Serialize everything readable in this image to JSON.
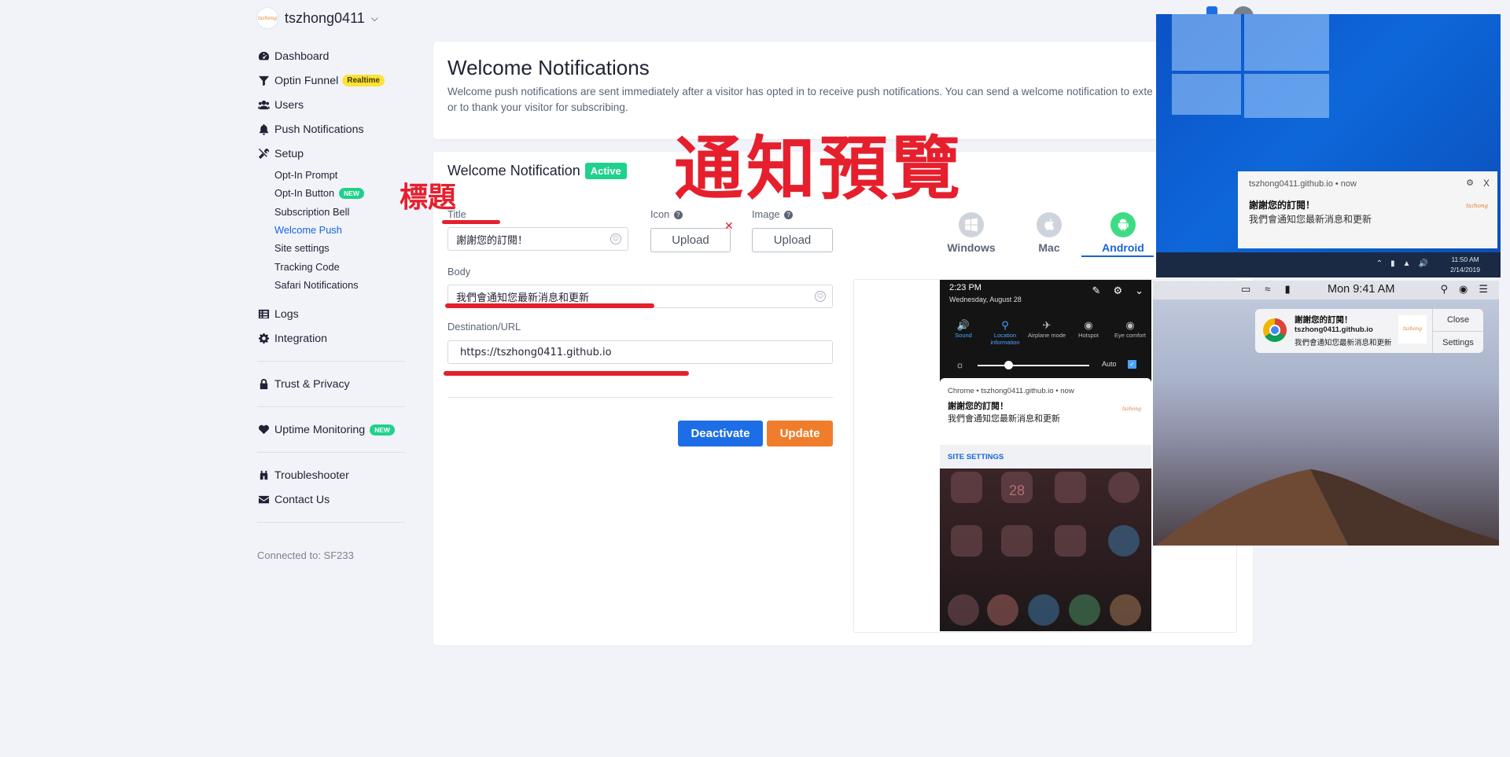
{
  "sidebar": {
    "account_name": "tszhong0411",
    "logo_text": "tszhong",
    "items": [
      {
        "label": "Dashboard",
        "icon": "dashboard-icon"
      },
      {
        "label": "Optin Funnel",
        "icon": "funnel-icon",
        "badge": "Realtime"
      },
      {
        "label": "Users",
        "icon": "users-icon"
      },
      {
        "label": "Push Notifications",
        "icon": "bell-icon"
      },
      {
        "label": "Setup",
        "icon": "tools-icon"
      }
    ],
    "setup_items": [
      "Opt-In Prompt",
      "Opt-In Button",
      "Subscription Bell",
      "Welcome Push",
      "Site settings",
      "Tracking Code",
      "Safari Notifications"
    ],
    "setup_new_badge": "NEW",
    "items2": [
      {
        "label": "Logs",
        "icon": "list-icon"
      },
      {
        "label": "Integration",
        "icon": "gear-icon"
      }
    ],
    "trust": "Trust & Privacy",
    "uptime": "Uptime Monitoring",
    "uptime_badge": "NEW",
    "troubleshooter": "Troubleshooter",
    "contact": "Contact Us",
    "connected": "Connected to: SF233"
  },
  "intro": {
    "title": "Welcome Notifications",
    "description": "Welcome push notifications are sent immediately after a visitor has opted in to receive push notifications. You can send a welcome notification to exte a warm welcome or to thank your visitor for subscribing."
  },
  "form": {
    "heading": "Welcome Notification",
    "status": "Active",
    "title_label": "Title",
    "title_value": "謝謝您的訂閱！",
    "icon_label": "Icon",
    "image_label": "Image",
    "upload": "Upload",
    "body_label": "Body",
    "body_value": "我們會通知您最新消息和更新",
    "url_label": "Destination/URL",
    "url_value": "https://tszhong0411.github.io",
    "deactivate": "Deactivate",
    "update": "Update"
  },
  "platforms": [
    {
      "label": "Windows",
      "icon": "windows-icon",
      "active": false
    },
    {
      "label": "Mac",
      "icon": "apple-icon",
      "active": false
    },
    {
      "label": "Android",
      "icon": "android-icon",
      "active": true
    }
  ],
  "android": {
    "time": "2:23 PM",
    "date": "Wednesday, August 28",
    "quick": [
      "Sound",
      "Location information",
      "Airplane mode",
      "Hotspot",
      "Eye comfort"
    ],
    "auto": "Auto",
    "app_line": "Chrome • tszhong0411.github.io • now",
    "title": "謝謝您的訂閱！",
    "body": "我們會通知您最新消息和更新",
    "site_settings": "SITE SETTINGS",
    "calendar_day": "28"
  },
  "windows": {
    "app_line": "tszhong0411.github.io • now",
    "title": "謝謝您的訂閱！",
    "body": "我們會通知您最新消息和更新",
    "close": "X",
    "clock_time": "11:50 AM",
    "clock_date": "2/14/2019"
  },
  "mac": {
    "time": "Mon 9:41 AM",
    "title": "謝謝您的訂閱！",
    "site": "tszhong0411.github.io",
    "body": "我們會通知您最新消息和更新",
    "close": "Close",
    "settings": "Settings"
  },
  "annotations": {
    "preview": "通知預覽",
    "title_mark": "標題"
  },
  "colors": {
    "accent_blue": "#1d6ee6",
    "update_orange": "#f07d2c",
    "active_green": "#1fd18a",
    "annotation_red": "#e61f2d"
  }
}
